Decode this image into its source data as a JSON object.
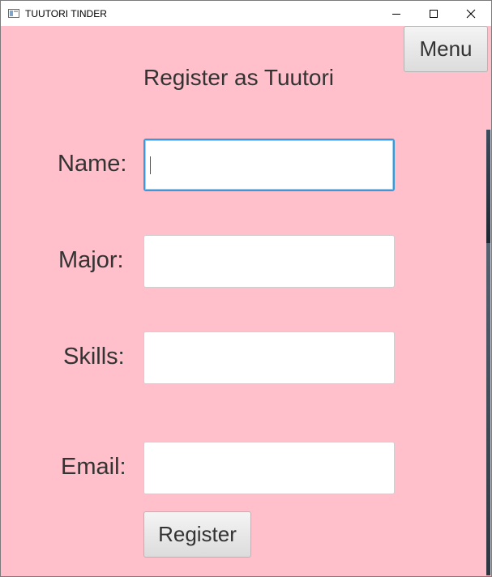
{
  "window": {
    "title": "TUUTORI TINDER",
    "app_icon": "window-app-icon",
    "controls": {
      "minimize_icon": "minimize-icon",
      "maximize_icon": "maximize-icon",
      "close_icon": "close-icon"
    }
  },
  "toolbar": {
    "menu_label": "Menu"
  },
  "form": {
    "heading": "Register as Tuutori",
    "fields": [
      {
        "label": "Name:",
        "value": "",
        "placeholder": "",
        "focused": true
      },
      {
        "label": "Major:",
        "value": "",
        "placeholder": "",
        "focused": false
      },
      {
        "label": "Skills:",
        "value": "",
        "placeholder": "",
        "focused": false
      },
      {
        "label": "Email:",
        "value": "",
        "placeholder": "",
        "focused": false
      }
    ],
    "submit_label": "Register"
  },
  "colors": {
    "background": "#ffc0cb",
    "focus_border": "#3a9ad9",
    "text": "#333333"
  }
}
